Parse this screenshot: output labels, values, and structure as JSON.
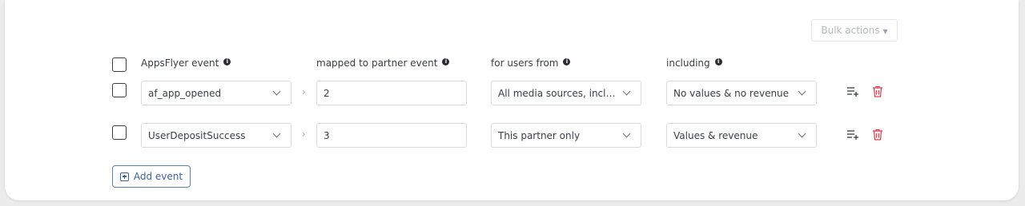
{
  "bulk_actions": {
    "label": "Bulk actions"
  },
  "headers": {
    "appsflyer_event": "AppsFlyer event",
    "mapped_to": "mapped to partner event",
    "for_users_from": "for users from",
    "including": "including"
  },
  "rows": [
    {
      "appsflyer_event": "af_app_opened",
      "partner_event": "2",
      "users_from": "All media sources, includi…",
      "including": "No values & no revenue"
    },
    {
      "appsflyer_event": "UserDepositSuccess",
      "partner_event": "3",
      "users_from": "This partner only",
      "including": "Values & revenue"
    }
  ],
  "add_event": {
    "label": "Add event"
  },
  "icons": {
    "info": "info-icon",
    "add_row": "playlist-add-icon",
    "delete": "trash-icon",
    "chevron": "chevron-down-icon",
    "arrow": "chevron-right-icon"
  },
  "colors": {
    "delete_icon": "#e0424f",
    "add_button": "#3e5f93"
  }
}
